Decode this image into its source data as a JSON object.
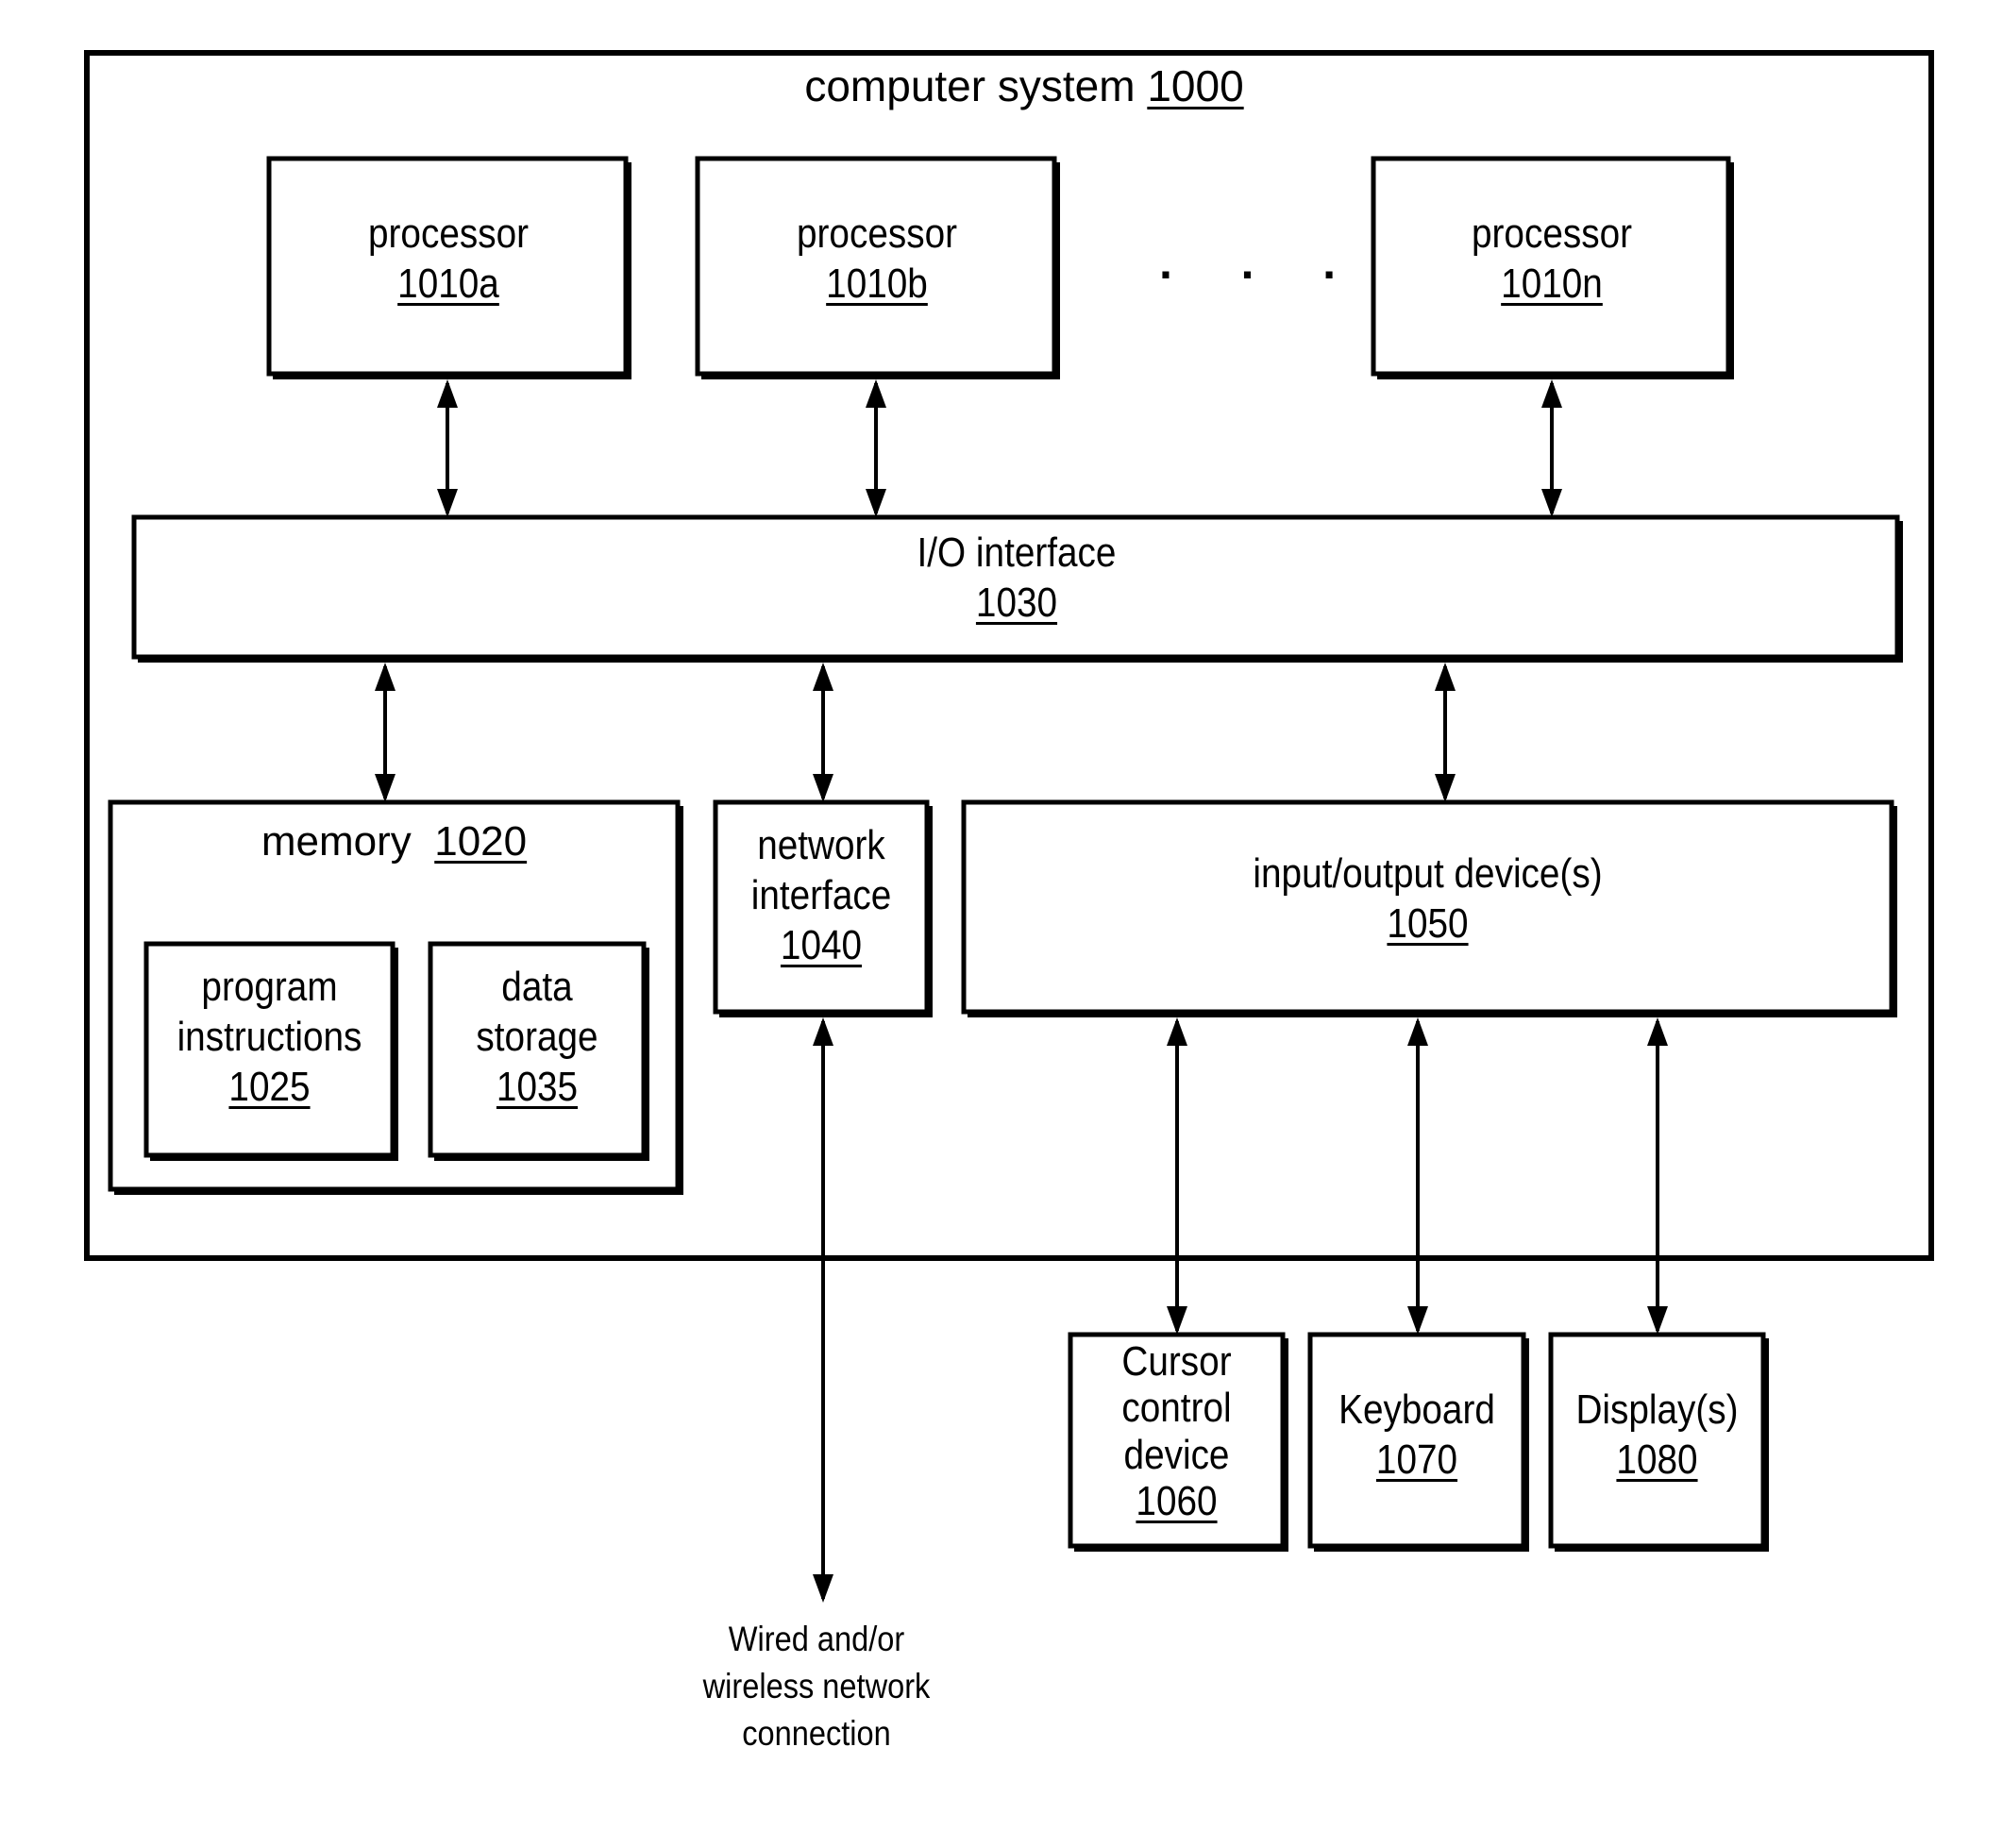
{
  "diagram": {
    "system": {
      "label": "computer system",
      "ref": "1000"
    },
    "processors": [
      {
        "label": "processor",
        "ref": "1010a"
      },
      {
        "label": "processor",
        "ref": "1010b"
      },
      {
        "label": "processor",
        "ref": "1010n"
      }
    ],
    "ellipsis": "· · ·",
    "io_interface": {
      "label": "I/O interface",
      "ref": "1030"
    },
    "memory": {
      "label": "memory",
      "ref": "1020"
    },
    "program_instructions": {
      "lines": [
        "program",
        "instructions"
      ],
      "ref": "1025"
    },
    "data_storage": {
      "lines": [
        "data",
        "storage"
      ],
      "ref": "1035"
    },
    "network_interface": {
      "lines": [
        "network",
        "interface"
      ],
      "ref": "1040"
    },
    "io_devices": {
      "label": "input/output device(s)",
      "ref": "1050"
    },
    "cursor_control": {
      "lines": [
        "Cursor",
        "control",
        "device"
      ],
      "ref": "1060"
    },
    "keyboard": {
      "label": "Keyboard",
      "ref": "1070"
    },
    "displays": {
      "label": "Display(s)",
      "ref": "1080"
    },
    "network_connection": {
      "lines": [
        "Wired and/or",
        "wireless network",
        "connection"
      ]
    },
    "connections": [
      {
        "from": "processor-1010a",
        "to": "io-interface-1030",
        "type": "bidirectional"
      },
      {
        "from": "processor-1010b",
        "to": "io-interface-1030",
        "type": "bidirectional"
      },
      {
        "from": "processor-1010n",
        "to": "io-interface-1030",
        "type": "bidirectional"
      },
      {
        "from": "io-interface-1030",
        "to": "memory-1020",
        "type": "bidirectional"
      },
      {
        "from": "io-interface-1030",
        "to": "network-interface-1040",
        "type": "bidirectional"
      },
      {
        "from": "io-interface-1030",
        "to": "io-devices-1050",
        "type": "bidirectional"
      },
      {
        "from": "io-devices-1050",
        "to": "cursor-control-1060",
        "type": "bidirectional"
      },
      {
        "from": "io-devices-1050",
        "to": "keyboard-1070",
        "type": "bidirectional"
      },
      {
        "from": "io-devices-1050",
        "to": "displays-1080",
        "type": "bidirectional"
      },
      {
        "from": "network-interface-1040",
        "to": "network-connection",
        "type": "bidirectional"
      }
    ]
  }
}
